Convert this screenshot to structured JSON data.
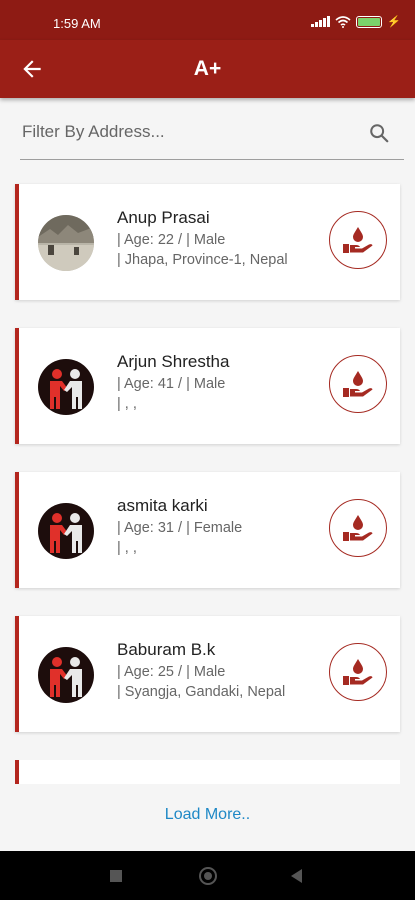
{
  "status_bar": {
    "time": "1:59 AM"
  },
  "app_bar": {
    "title": "A+"
  },
  "search": {
    "placeholder": "Filter By Address..."
  },
  "donors": [
    {
      "name": "Anup Prasai",
      "age_line": "|  Age: 22 / |  Male",
      "address_line": "|  Jhapa, Province-1, Nepal",
      "avatar": "photo"
    },
    {
      "name": "Arjun Shrestha",
      "age_line": "|  Age: 41 / |  Male",
      "address_line": "|  , ,",
      "avatar": "default-icon"
    },
    {
      "name": "asmita karki",
      "age_line": "|  Age: 31 / |  Female",
      "address_line": "|  , ,",
      "avatar": "default-icon"
    },
    {
      "name": "Baburam B.k",
      "age_line": "|  Age: 25 / |  Male",
      "address_line": "|  Syangja, Gandaki, Nepal",
      "avatar": "default-icon"
    }
  ],
  "load_more": "Load More..",
  "colors": {
    "primary": "#9b1f17",
    "status_bar": "#8e1b14",
    "accent_link": "#1e88c6",
    "card_border": "#b3261e"
  },
  "icons": {
    "back": "arrow-left-icon",
    "search": "search-icon",
    "donate": "blood-donation-hand-icon"
  }
}
